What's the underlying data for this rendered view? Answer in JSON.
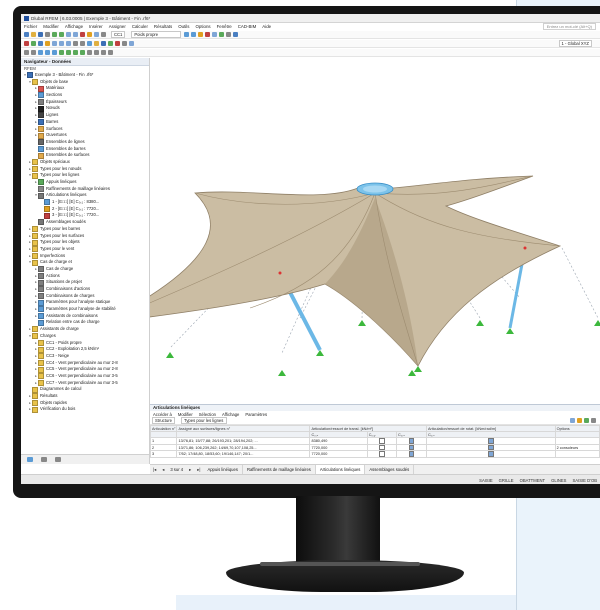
{
  "window": {
    "title": "Dlubal RFEM | 6.03.0005 | Exemple 3 - Bâtiment - Fin .rf6*"
  },
  "menu": {
    "items": [
      "Fichier",
      "Modifier",
      "Affichage",
      "Insérer",
      "Assigner",
      "Calculer",
      "Résultats",
      "Outils",
      "Options",
      "Fenêtre",
      "CAD-BIM",
      "Aide"
    ],
    "search_placeholder": "Entrez un mot-clé (Alt+Q)"
  },
  "toolbar": {
    "loadcase_code": "CC1",
    "loadcase_name": "Poids propre",
    "view_label": "1 - Global XYZ"
  },
  "navigator": {
    "title": "Navigateur - Données",
    "project": "RFEM",
    "items": [
      {
        "label": "Exemple 3 - Bâtiment - Fin .rf6*",
        "level": 0,
        "color": "#3b6fb6",
        "arrow": "v"
      },
      {
        "label": "Objets de base",
        "level": 1,
        "color": "#e8c24a",
        "arrow": "v"
      },
      {
        "label": "Matériaux",
        "level": 2,
        "color": "#d9534f",
        "arrow": ">"
      },
      {
        "label": "Sections",
        "level": 2,
        "color": "#5b9bd5",
        "arrow": ">"
      },
      {
        "label": "Épaisseurs",
        "level": 2,
        "color": "#7f7f7f",
        "arrow": ">"
      },
      {
        "label": "Nœuds",
        "level": 2,
        "color": "#222222",
        "arrow": ">"
      },
      {
        "label": "Lignes",
        "level": 2,
        "color": "#444444",
        "arrow": ">"
      },
      {
        "label": "Barres",
        "level": 2,
        "color": "#3b6fb6",
        "arrow": ">"
      },
      {
        "label": "Surfaces",
        "level": 2,
        "color": "#e0a84a",
        "arrow": ">"
      },
      {
        "label": "Ouvertures",
        "level": 2,
        "color": "#e0a84a",
        "arrow": ">"
      },
      {
        "label": "Ensembles de lignes",
        "level": 2,
        "color": "#666666",
        "arrow": ""
      },
      {
        "label": "Ensembles de barres",
        "level": 2,
        "color": "#5b9bd5",
        "arrow": ""
      },
      {
        "label": "Ensembles de surfaces",
        "level": 2,
        "color": "#e0a84a",
        "arrow": ""
      },
      {
        "label": "Objets spéciaux",
        "level": 1,
        "color": "#e8c24a",
        "arrow": ">"
      },
      {
        "label": "Types pour les nœuds",
        "level": 1,
        "color": "#e8c24a",
        "arrow": ">"
      },
      {
        "label": "Types pour les lignes",
        "level": 1,
        "color": "#e8c24a",
        "arrow": "v"
      },
      {
        "label": "Appuis linéiques",
        "level": 2,
        "color": "#5aa95a",
        "arrow": ">"
      },
      {
        "label": "Raffinements de maillage linéaires",
        "level": 2,
        "color": "#888888",
        "arrow": ""
      },
      {
        "label": "Articulations linéiques",
        "level": 2,
        "color": "#777777",
        "arrow": "v"
      },
      {
        "label": "1 - [E□□] [E] C₀,₁ : 8380...",
        "level": 3,
        "color": "#5b9bd5",
        "arrow": ""
      },
      {
        "label": "2 - [E□□] [E] C₀,₁ : 7720...",
        "level": 3,
        "color": "#e0a020",
        "arrow": ""
      },
      {
        "label": "3 - [E□□] [E] C₀,₁ : 7720...",
        "level": 3,
        "color": "#c04040",
        "arrow": ""
      },
      {
        "label": "Assemblages soudés",
        "level": 2,
        "color": "#777777",
        "arrow": ""
      },
      {
        "label": "Types pour les barres",
        "level": 1,
        "color": "#e8c24a",
        "arrow": ">"
      },
      {
        "label": "Types pour les surfaces",
        "level": 1,
        "color": "#e8c24a",
        "arrow": ">"
      },
      {
        "label": "Types pour les objets",
        "level": 1,
        "color": "#e8c24a",
        "arrow": ">"
      },
      {
        "label": "Types pour le vent",
        "level": 1,
        "color": "#e8c24a",
        "arrow": ">"
      },
      {
        "label": "Imperfections",
        "level": 1,
        "color": "#e8c24a",
        "arrow": ">"
      },
      {
        "label": "Cas de charge et",
        "level": 1,
        "color": "#e8c24a",
        "arrow": "v"
      },
      {
        "label": "Cas de charge",
        "level": 2,
        "color": "#7f7f7f",
        "arrow": ">"
      },
      {
        "label": "Actions",
        "level": 2,
        "color": "#7f7f7f",
        "arrow": ">"
      },
      {
        "label": "Situations de projet",
        "level": 2,
        "color": "#7f7f7f",
        "arrow": ">"
      },
      {
        "label": "Combinaisons d'actions",
        "level": 2,
        "color": "#7f7f7f",
        "arrow": ">"
      },
      {
        "label": "Combinaisons de charges",
        "level": 2,
        "color": "#7f7f7f",
        "arrow": ">"
      },
      {
        "label": "Paramètres pour l'analyse statique",
        "level": 2,
        "color": "#5b9bd5",
        "arrow": ">"
      },
      {
        "label": "Paramètres pour l'analyse de stabilité",
        "level": 2,
        "color": "#5b9bd5",
        "arrow": ">"
      },
      {
        "label": "Assistants de combinaisons",
        "level": 2,
        "color": "#5b9bd5",
        "arrow": ">"
      },
      {
        "label": "Relation entre cas de charge",
        "level": 2,
        "color": "#5b9bd5",
        "arrow": ""
      },
      {
        "label": "Assistants de charge",
        "level": 1,
        "color": "#e8c24a",
        "arrow": ">"
      },
      {
        "label": "Charges",
        "level": 1,
        "color": "#e8c24a",
        "arrow": "v"
      },
      {
        "label": "CC1 - Poids propre",
        "level": 2,
        "color": "#e8c24a",
        "arrow": ">"
      },
      {
        "label": "CC2 - Exploitation 2,5 kN/m²",
        "level": 2,
        "color": "#e8c24a",
        "arrow": ">"
      },
      {
        "label": "CC3 - Neige",
        "level": 2,
        "color": "#e8c24a",
        "arrow": ">"
      },
      {
        "label": "CC4 - Vent perpendiculaire au mur 2-8",
        "level": 2,
        "color": "#e8c24a",
        "arrow": ">"
      },
      {
        "label": "CC5 - Vent perpendiculaire au mur 2-8",
        "level": 2,
        "color": "#e8c24a",
        "arrow": ">"
      },
      {
        "label": "CC6 - Vent perpendiculaire au mur 3-5",
        "level": 2,
        "color": "#e8c24a",
        "arrow": ">"
      },
      {
        "label": "CC7 - Vent perpendiculaire au mur 3-5",
        "level": 2,
        "color": "#e8c24a",
        "arrow": ">"
      },
      {
        "label": "Diagrammes de calcul",
        "level": 1,
        "color": "#e8c24a",
        "arrow": ""
      },
      {
        "label": "Résultats",
        "level": 1,
        "color": "#e8c24a",
        "arrow": ">"
      },
      {
        "label": "Objets rapides",
        "level": 1,
        "color": "#e8c24a",
        "arrow": ">"
      },
      {
        "label": "Vérification du bois",
        "level": 1,
        "color": "#e8c24a",
        "arrow": ">"
      }
    ]
  },
  "panel": {
    "title": "Articulations linéiques",
    "menu": [
      "Accéder à",
      "Modifier",
      "Sélection",
      "Affichage",
      "Paramètres"
    ],
    "filter_label": "Structure",
    "type_filter": "Types pour les lignes",
    "columns": {
      "no": "Articulation n°",
      "assigned": "Assigné aux surfaces/lignes n°",
      "translation_group": "Articulation/ressort de transl. [kN/m²]",
      "cux": "C₀,ₓ",
      "cuy": "C₀,ᵧ",
      "cuz": "C₀,ᵤ",
      "rotation_group": "Articulation/ressort de rotat. [kNm/rad/m]",
      "cphx": "C₀,ₓ",
      "options": "Options"
    },
    "rows": [
      {
        "no": "1",
        "assigned": "13/76,81; 15/77,88; 26/193,201; 28/194,202; ...",
        "cux": "8380,490",
        "uy": false,
        "uz": true,
        "rx": true,
        "options": ""
      },
      {
        "no": "2",
        "assigned": "13/71,86; 106,239,262; 14/69,70,107,108,25...",
        "cux": "7720,000",
        "uy": false,
        "uz": true,
        "rx": true,
        "options": "2 consoleurs"
      },
      {
        "no": "3",
        "assigned": "7/52; 17/48,80, 18/53,60; 19/146,147; 20/1...",
        "cux": "7720,000",
        "uy": false,
        "uz": true,
        "rx": true,
        "options": ""
      }
    ],
    "pager": "3 sur 4",
    "tabs": [
      "Appuis linéiques",
      "Raffinements de maillage linéaires",
      "Articulations linéiques",
      "Assemblages soudés"
    ],
    "active_tab": "Articulations linéiques"
  },
  "status": {
    "items": [
      "SAISIE",
      "GRILLE",
      "OBATTMENT",
      "GLINES",
      "SAISIE D'OB"
    ]
  },
  "colors": {
    "membrane": "#cbbda3",
    "membrane_dark": "#a9977b",
    "mast": "#6cb8e6",
    "support": "#3cb83c",
    "accent": "#1f4e9c"
  }
}
